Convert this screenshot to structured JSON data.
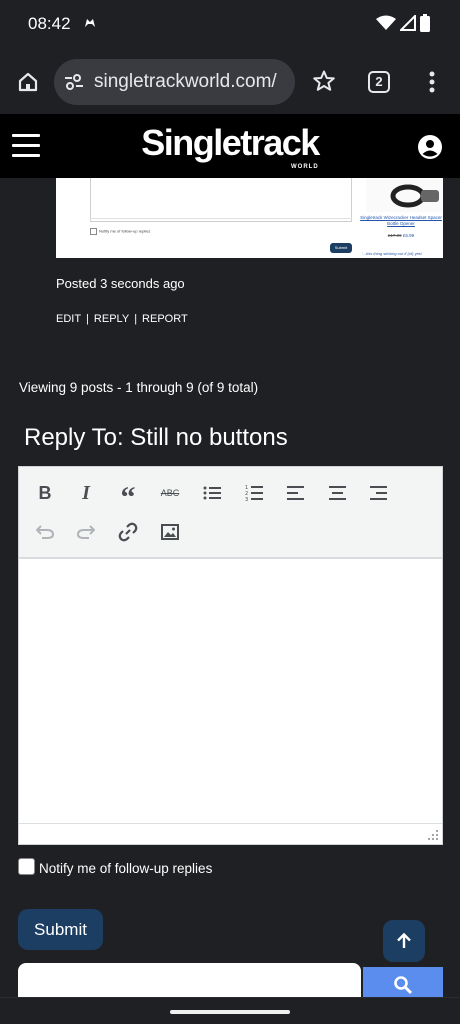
{
  "status_bar": {
    "time": "08:42",
    "app_icon": "game-controller-icon",
    "icons": [
      "wifi-icon",
      "signal-icon",
      "battery-icon"
    ]
  },
  "browser": {
    "url": "singletrackworld.com/",
    "tab_count": "2",
    "icons": {
      "home": "home-icon",
      "site_info": "tune-icon",
      "bookmark": "star-icon",
      "menu": "more-vert-icon"
    }
  },
  "site_header": {
    "logo": "Singletrack",
    "logo_sub": "WORLD"
  },
  "embedded_screenshot": {
    "notify_text": "Notify me of follow-up replies",
    "submit_label": "Submit",
    "product_name": "Singletrack Wizecracker Headset Spacer Bottle Opener",
    "price_old": "£17.99",
    "price_new": "£5.99",
    "note": "'...this thing sticking out if (of) yes!"
  },
  "post": {
    "posted": "Posted 3 seconds ago",
    "actions": [
      "EDIT",
      "REPLY",
      "REPORT"
    ]
  },
  "topic": {
    "viewing": "Viewing 9 posts - 1 through 9 (of 9 total)",
    "reply_title": "Reply To: Still no buttons"
  },
  "editor": {
    "toolbar": {
      "bold": "B",
      "italic": "I",
      "quote": "“",
      "strike": "ABC"
    },
    "content": ""
  },
  "form": {
    "notify_label": "Notify me of follow-up replies",
    "notify_checked": false,
    "submit_label": "Submit"
  },
  "search": {
    "placeholder": ""
  },
  "colors": {
    "background": "#1f2024",
    "header": "#000000",
    "button": "#1c3e63",
    "search_button": "#5b8def"
  }
}
